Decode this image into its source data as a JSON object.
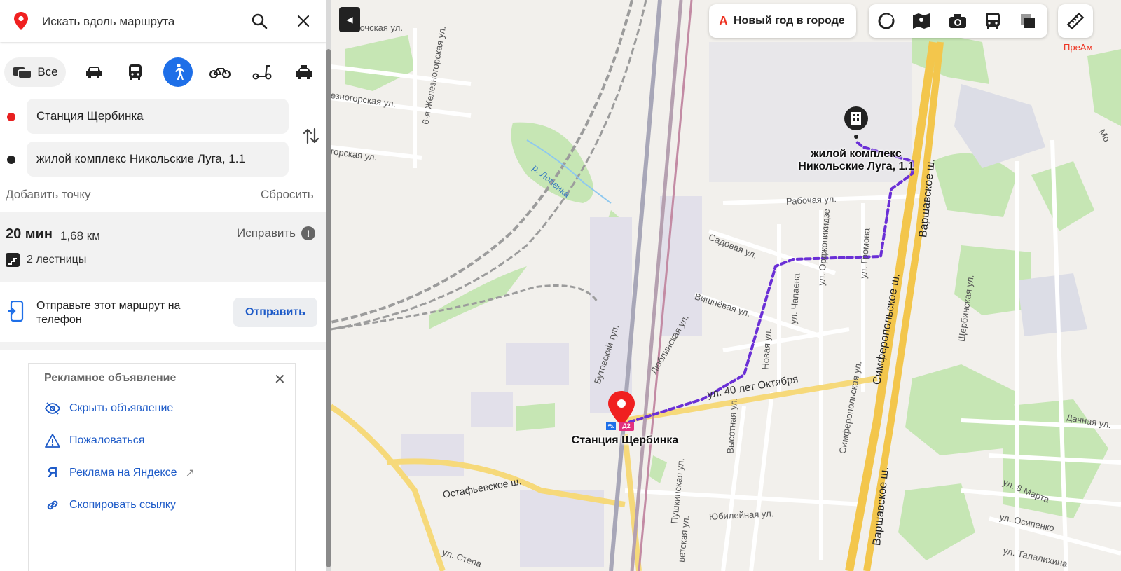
{
  "search": {
    "placeholder": "Искать вдоль маршрута"
  },
  "modes": {
    "all_label": "Все"
  },
  "route": {
    "from": "Станция Щербинка",
    "to": "жилой комплекс Никольские Луга, 1.1",
    "add_point": "Добавить точку",
    "reset": "Сбросить"
  },
  "summary": {
    "time": "20 мин",
    "distance": "1,68 км",
    "fix": "Исправить",
    "stairs": "2 лестницы"
  },
  "send": {
    "text": "Отправьте этот маршрут на телефон",
    "button": "Отправить"
  },
  "ad": {
    "title": "Рекламное объявление",
    "hide": "Скрыть объявление",
    "report": "Пожаловаться",
    "yandex_ads": "Реклама на Яндексе",
    "copy_link": "Скопировать ссылку"
  },
  "map": {
    "promo_letter": "А",
    "promo": "Новый год в городе",
    "corner_label": "ПреАм",
    "start_label": "Станция Щербинка",
    "end_label": "жилой комплекс Никольские Луга, 1.1",
    "station_badge": "Д2",
    "streets": {
      "s1": "бочская ул.",
      "s2": "6-я Железногорская ул.",
      "s3": "езногорская ул.",
      "s4": "горская ул.",
      "river": "р. Лопенка",
      "s5": "Рабочая ул.",
      "s6": "Садовая ул.",
      "s7": "ул. Орджоникидзе",
      "s8": "ул. Громова",
      "s9": "Варшавское ш.",
      "s10": "Бутовский туп.",
      "s11": "Вишнёвая ул.",
      "s12": "ул. Чапаева",
      "s13": "Новая ул.",
      "s14": "Люблинская ул.",
      "s15": "ул. 40 лет Октября",
      "s16": "Симферопольское ш.",
      "s17": "Симферопольская ул.",
      "s18": "Высотная ул.",
      "s19": "Пушкинская ул.",
      "s20": "Юбилейная ул.",
      "s21": "Остафьевское ш.",
      "s22": "ул. Степа",
      "s23": "Варшавское ш.",
      "s24": "Дачная ул.",
      "s25": "ул. 8 Марта",
      "s26": "ул. Осипенко",
      "s27": "ул. Талалихина",
      "s28": "Щербинская ул.",
      "s29": "Мо",
      "s30": "ветская ул."
    }
  },
  "colors": {
    "accent": "#1e6fe8",
    "route": "#6a2fd6",
    "pin": "#f02020"
  }
}
